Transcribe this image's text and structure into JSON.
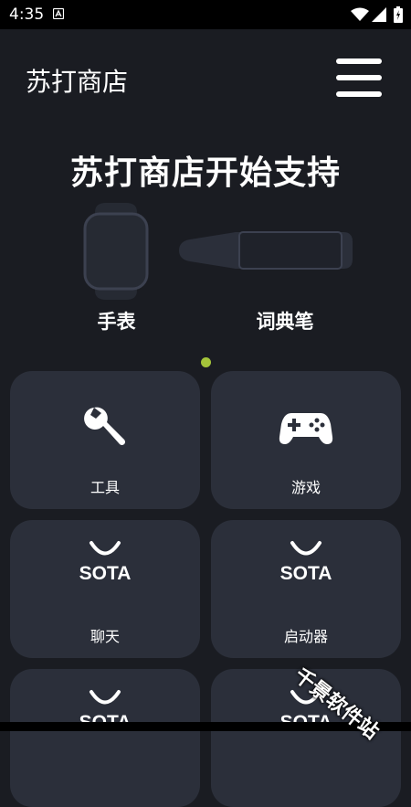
{
  "status_bar": {
    "time": "4:35",
    "icons": [
      "notification-a-icon",
      "wifi-icon",
      "cell-signal-icon",
      "battery-icon"
    ]
  },
  "header": {
    "title": "苏打商店",
    "menu_icon": "hamburger-icon"
  },
  "banner": {
    "title": "苏打商店开始支持",
    "devices": [
      {
        "label": "手表",
        "icon": "watch-icon"
      },
      {
        "label": "词典笔",
        "icon": "dictionary-pen-icon"
      }
    ],
    "page_indicator_color": "#a4c43a"
  },
  "categories": [
    {
      "label": "工具",
      "icon": "wrench-icon"
    },
    {
      "label": "游戏",
      "icon": "gamepad-icon"
    },
    {
      "label": "聊天",
      "logo_text": "SOTA"
    },
    {
      "label": "启动器",
      "logo_text": "SOTA"
    },
    {
      "label": "",
      "logo_text": "SOTA"
    },
    {
      "label": "",
      "logo_text": "SOTA"
    }
  ],
  "watermark": "千景软件站",
  "colors": {
    "background": "#1a1c22",
    "card": "#2b2f3a",
    "accent": "#a4c43a"
  }
}
